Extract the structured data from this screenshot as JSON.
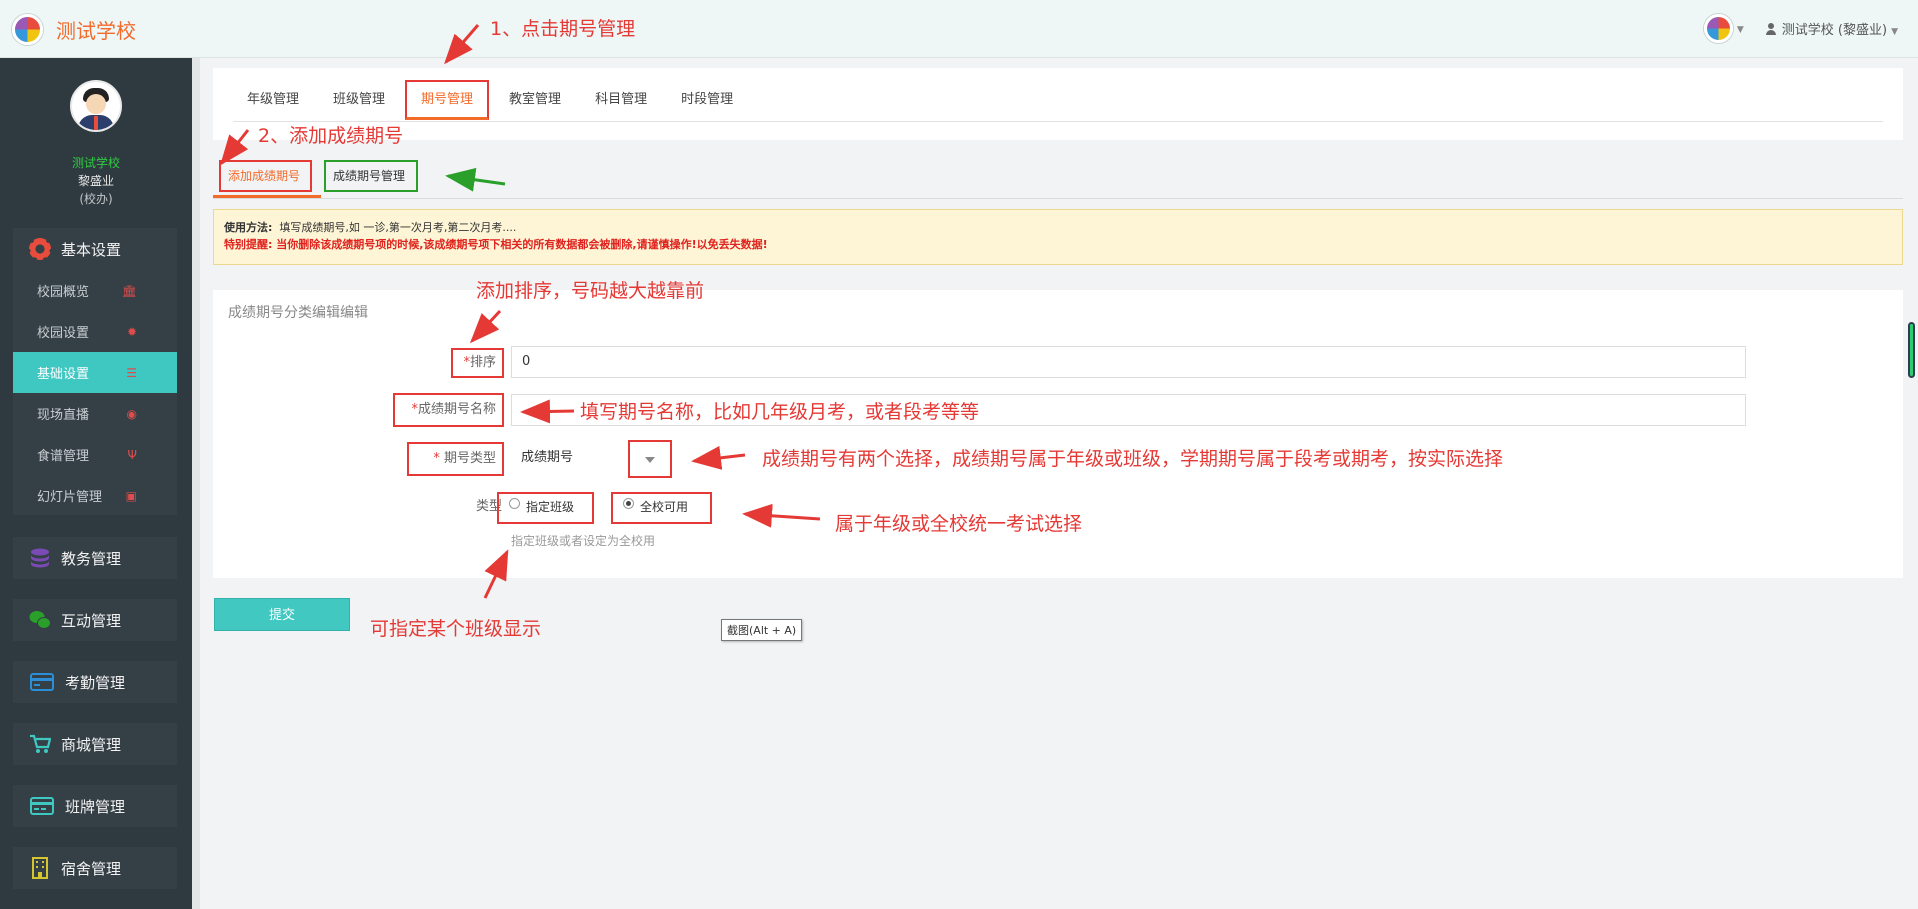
{
  "header": {
    "school_name": "测试学校",
    "user_label": "测试学校 (黎盛业)"
  },
  "sidebar": {
    "profile": {
      "school": "测试学校",
      "name": "黎盛业",
      "role": "(校办)"
    },
    "basic_settings": {
      "label": "基本设置",
      "items": [
        {
          "label": "校园概览",
          "icon": "bank-icon"
        },
        {
          "label": "校园设置",
          "icon": "gear-icon"
        },
        {
          "label": "基础设置",
          "icon": "list-icon",
          "active": true
        },
        {
          "label": "现场直播",
          "icon": "eye-icon"
        },
        {
          "label": "食谱管理",
          "icon": "cutlery-icon"
        },
        {
          "label": "幻灯片管理",
          "icon": "picture-icon"
        }
      ]
    },
    "groups": [
      {
        "label": "教务管理",
        "icon": "database-icon",
        "color": "#7b4bb5"
      },
      {
        "label": "互动管理",
        "icon": "wechat-icon",
        "color": "#2aa02a"
      },
      {
        "label": "考勤管理",
        "icon": "card-icon",
        "color": "#2b8fd8"
      },
      {
        "label": "商城管理",
        "icon": "cart-icon",
        "color": "#3fc7c2"
      },
      {
        "label": "班牌管理",
        "icon": "credit-card-icon",
        "color": "#3fc7c2"
      },
      {
        "label": "宿舍管理",
        "icon": "building-icon",
        "color": "#d6c52e"
      }
    ]
  },
  "tabs": [
    "年级管理",
    "班级管理",
    "期号管理",
    "教室管理",
    "科目管理",
    "时段管理"
  ],
  "active_tab": "期号管理",
  "subtabs": {
    "add": "添加成绩期号",
    "manage": "成绩期号管理"
  },
  "notice": {
    "usage_label": "使用方法:",
    "usage_text": "填写成绩期号,如 一诊,第一次月考,第二次月考....",
    "warning": "特别提醒: 当你删除该成绩期号项的时候,该成绩期号项下相关的所有数据都会被删除,请谨慎操作!以免丢失数据!"
  },
  "form": {
    "title": "成绩期号分类编辑编辑",
    "order_label": "排序",
    "order_value": "0",
    "name_label": "成绩期号名称",
    "name_value": "",
    "type_label": " 期号类型",
    "type_value": "成绩期号",
    "scope_label": "类型",
    "scope_options": [
      "指定班级",
      "全校可用"
    ],
    "scope_selected": "全校可用",
    "scope_help": "指定班级或者设定为全校用",
    "submit_label": "提交"
  },
  "tooltip": "截图(Alt + A)",
  "annotations": {
    "step1": "1、点击期号管理",
    "step2": "2、添加成绩期号",
    "order": "添加排序，号码越大越靠前",
    "name": "填写期号名称，比如几年级月考，或者段考等等",
    "type": "成绩期号有两个选择，成绩期号属于年级或班级，学期期号属于段考或期考，按实际选择",
    "scope": "属于年级或全校统一考试选择",
    "class": "可指定某个班级显示"
  },
  "colors": {
    "accent": "#3fc7c2",
    "brand": "#f36b2b",
    "annotation": "#e53935",
    "sidebar": "#2f3a40"
  }
}
